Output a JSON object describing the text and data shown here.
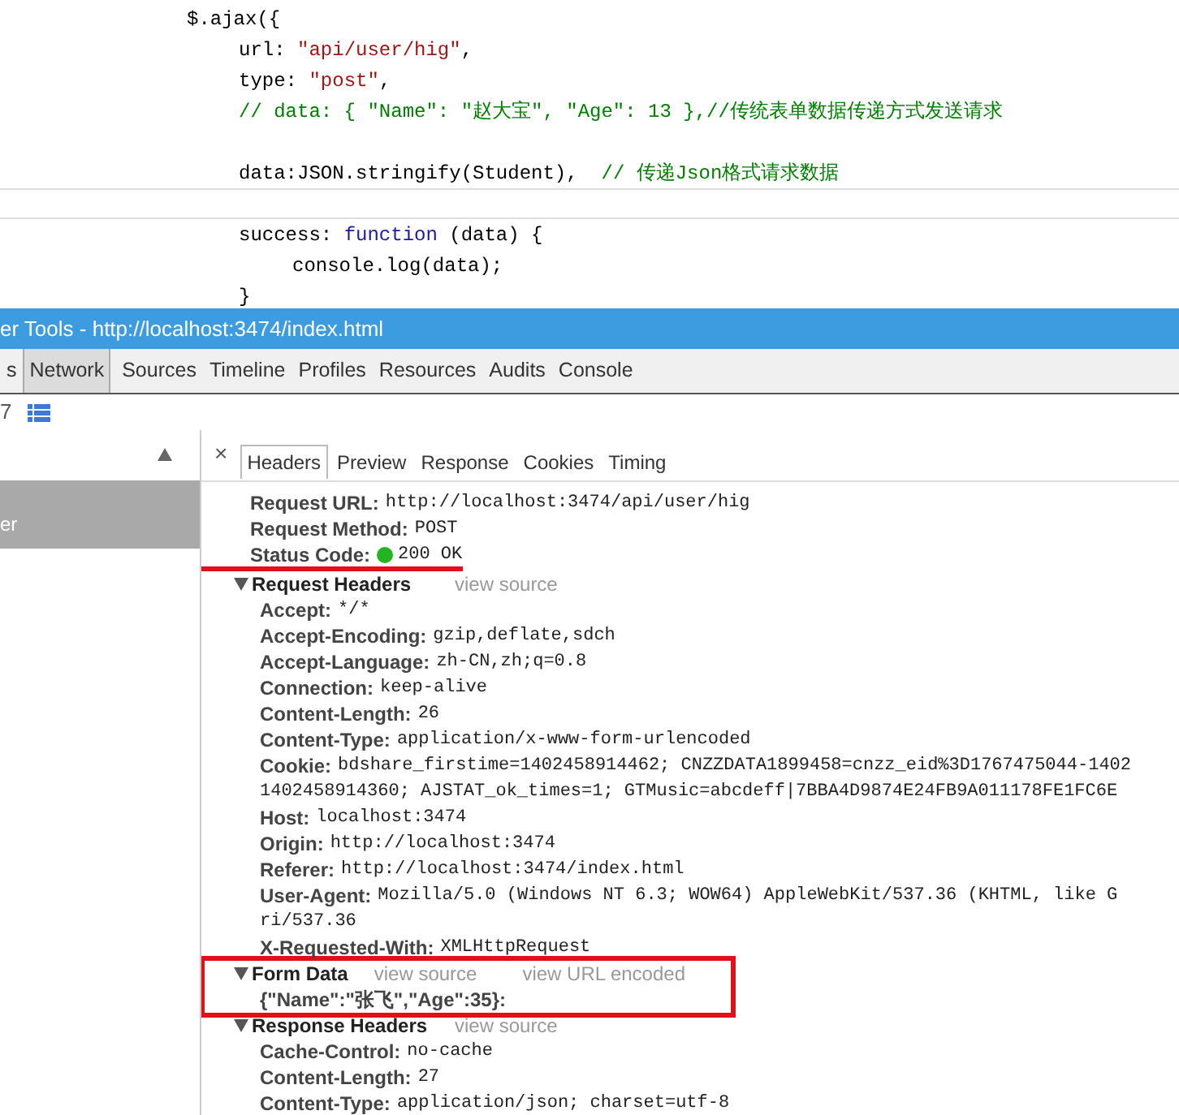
{
  "editor": {
    "lines": [
      {
        "current": false,
        "tokens": [
          {
            "kind": "plain",
            "text": "$.ajax({"
          }
        ],
        "children": [
          {
            "current": false,
            "tokens": [
              {
                "kind": "plain",
                "text": "url: "
              },
              {
                "kind": "string",
                "text": "\"api/user/hig\""
              },
              {
                "kind": "plain",
                "text": ","
              }
            ]
          },
          {
            "current": false,
            "tokens": [
              {
                "kind": "plain",
                "text": "type: "
              },
              {
                "kind": "string",
                "text": "\"post\""
              },
              {
                "kind": "plain",
                "text": ","
              }
            ]
          },
          {
            "current": false,
            "tokens": [
              {
                "kind": "comment",
                "text": "// data: { \"Name\": \"赵大宝\", \"Age\": 13 },//传统表单数据传递方式发送请求"
              }
            ]
          },
          {
            "current": false
          },
          {
            "current": false,
            "tokens": [
              {
                "kind": "plain",
                "text": "data:JSON.stringify(Student),  "
              },
              {
                "kind": "comment",
                "text": "// 传递Json格式请求数据"
              }
            ]
          },
          {
            "current": true
          },
          {
            "current": false,
            "tokens": [
              {
                "kind": "plain",
                "text": "success: "
              },
              {
                "kind": "keyword",
                "text": "function"
              },
              {
                "kind": "plain",
                "text": " (data) {"
              }
            ],
            "children": [
              {
                "current": false,
                "tokens": [
                  {
                    "kind": "plain",
                    "text": "console.log(data);"
                  }
                ]
              }
            ]
          },
          {
            "current": false,
            "tokens": [
              {
                "kind": "plain",
                "text": "}"
              }
            ]
          }
        ]
      }
    ]
  },
  "devtools": {
    "title": "er Tools - http://localhost:3474/index.html",
    "panel_tabs": [
      {
        "label": "s",
        "selected": false
      },
      {
        "label": "Network",
        "selected": true
      },
      {
        "label": "Sources",
        "selected": false
      },
      {
        "label": "Timeline",
        "selected": false
      },
      {
        "label": "Profiles",
        "selected": false
      },
      {
        "label": "Resources",
        "selected": false
      },
      {
        "label": "Audits",
        "selected": false
      },
      {
        "label": "Console",
        "selected": false
      }
    ],
    "toolbar_text": "7",
    "request_list": [
      {
        "label": "er",
        "selected": true
      }
    ],
    "close": "×",
    "detail_tabs": [
      {
        "label": "Headers",
        "selected": true
      },
      {
        "label": "Preview",
        "selected": false
      },
      {
        "label": "Response",
        "selected": false
      },
      {
        "label": "Cookies",
        "selected": false
      },
      {
        "label": "Timing",
        "selected": false
      }
    ],
    "general": [
      {
        "name": "Request URL:",
        "value": "http://localhost:3474/api/user/hig",
        "underlined": false
      },
      {
        "name": "Request Method:",
        "value": "POST",
        "underlined": false
      },
      {
        "name": "Status Code:",
        "value": "200 OK",
        "underlined": true
      }
    ],
    "sections": [
      {
        "title": "Request Headers",
        "expanded": true,
        "boxed": false,
        "links": [
          "view source"
        ],
        "items": [
          {
            "name": "Accept:",
            "value": "*/*"
          },
          {
            "name": "Accept-Encoding:",
            "value": "gzip,deflate,sdch"
          },
          {
            "name": "Accept-Language:",
            "value": "zh-CN,zh;q=0.8"
          },
          {
            "name": "Connection:",
            "value": "keep-alive"
          },
          {
            "name": "Content-Length:",
            "value": "26"
          },
          {
            "name": "Content-Type:",
            "value": "application/x-www-form-urlencoded"
          },
          {
            "name": "Cookie:",
            "value": "bdshare_firstime=1402458914462; CNZZDATA1899458=cnzz_eid%3D1767475044-1402",
            "value_cont": "1402458914360; AJSTAT_ok_times=1; GTMusic=abcdeff|7BBA4D9874E24FB9A011178FE1FC6E"
          },
          {
            "name": "Host:",
            "value": "localhost:3474"
          },
          {
            "name": "Origin:",
            "value": "http://localhost:3474"
          },
          {
            "name": "Referer:",
            "value": "http://localhost:3474/index.html"
          },
          {
            "name": "User-Agent:",
            "value": "Mozilla/5.0 (Windows NT 6.3; WOW64) AppleWebKit/537.36 (KHTML, like G",
            "value_cont": "ri/537.36"
          },
          {
            "name": "X-Requested-With:",
            "value": "XMLHttpRequest"
          }
        ]
      },
      {
        "title": "Form Data",
        "expanded": true,
        "boxed": true,
        "links": [
          "view source",
          "view URL encoded"
        ],
        "items": [
          {
            "name": "{\"Name\":\"张飞\",\"Age\":35}:"
          }
        ]
      },
      {
        "title": "Response Headers",
        "expanded": true,
        "boxed": false,
        "links": [
          "view source"
        ],
        "items": [
          {
            "name": "Cache-Control:",
            "value": "no-cache"
          },
          {
            "name": "Content-Length:",
            "value": "27"
          },
          {
            "name": "Content-Type:",
            "value": "application/json; charset=utf-8"
          }
        ]
      }
    ]
  }
}
